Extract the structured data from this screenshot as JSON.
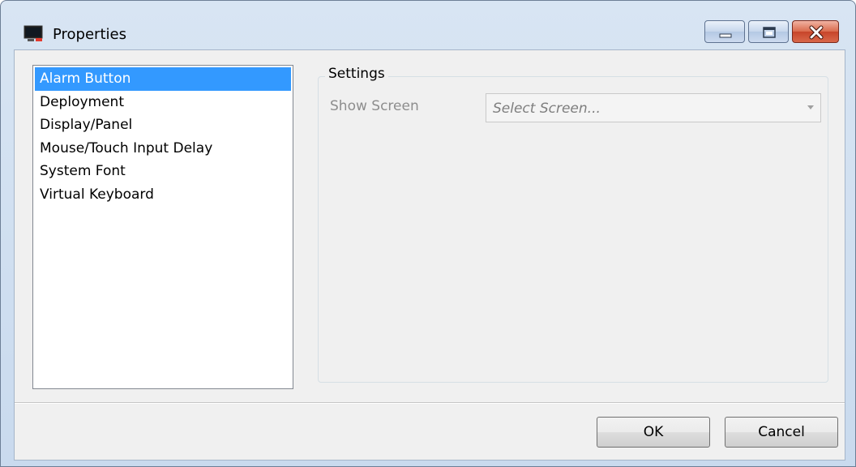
{
  "window": {
    "title": "Properties",
    "icon": "monitor-app-icon",
    "controls": [
      "minimize-icon",
      "maximize-icon",
      "close-icon"
    ]
  },
  "sidebar": {
    "items": [
      {
        "label": "Alarm Button",
        "selected": true
      },
      {
        "label": "Deployment",
        "selected": false
      },
      {
        "label": "Display/Panel",
        "selected": false
      },
      {
        "label": "Mouse/Touch Input Delay",
        "selected": false
      },
      {
        "label": "System Font",
        "selected": false
      },
      {
        "label": "Virtual Keyboard",
        "selected": false
      }
    ]
  },
  "settings": {
    "group_title": "Settings",
    "show_screen_label": "Show Screen",
    "show_screen_value": "Select Screen...",
    "enabled": false
  },
  "footer": {
    "ok_label": "OK",
    "cancel_label": "Cancel"
  },
  "colors": {
    "selection": "#3399ff",
    "close_button": "#c7452a",
    "disabled_text": "#8d8d8d"
  }
}
